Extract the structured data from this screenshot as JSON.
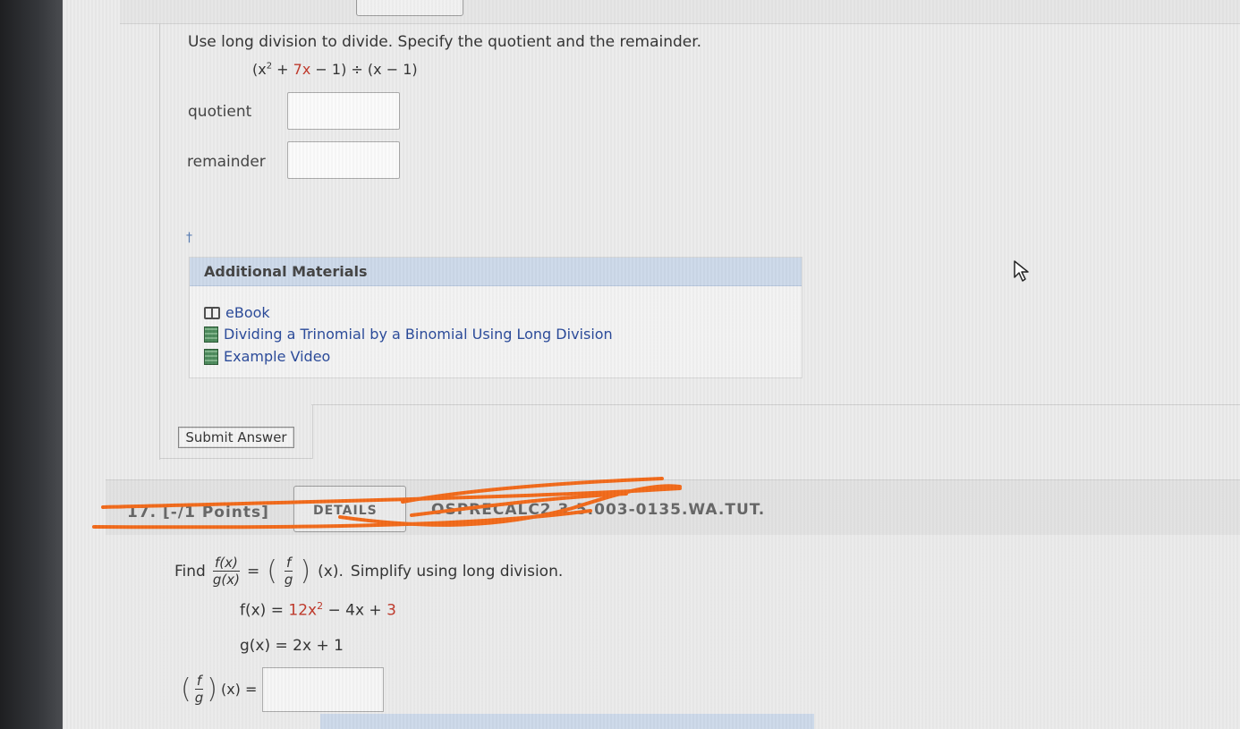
{
  "question": {
    "instruction": "Use long division to divide. Specify the quotient and the remainder.",
    "expression": {
      "part1": "(x",
      "exp": "2",
      "part2": " + ",
      "term2": "7x",
      "part3": " − 1) ÷ (x − 1)"
    },
    "fields": [
      {
        "label": "quotient",
        "value": ""
      },
      {
        "label": "remainder",
        "value": ""
      }
    ],
    "dagger": "†"
  },
  "additional_materials": {
    "header": "Additional Materials",
    "items": [
      {
        "label": "eBook",
        "icon": "book-icon"
      },
      {
        "label": "Dividing a Trinomial by a Binomial Using Long Division",
        "icon": "video-icon"
      },
      {
        "label": "Example Video",
        "icon": "video-icon"
      }
    ]
  },
  "submit": {
    "label": "Submit Answer"
  },
  "q17": {
    "number_points": "17. [-/1 Points]",
    "details_label": "DETAILS",
    "code": "OSPRECALC2 3.5.003-0135.WA.TUT.",
    "find": "Find",
    "f_num": "f(x)",
    "g_den": "g(x)",
    "eq": "=",
    "f": "f",
    "g": "g",
    "of_x": "(x).",
    "simplify": "Simplify using long division.",
    "fx_lhs": "f(x) = ",
    "fx_coef": "12x",
    "fx_exp": "2",
    "fx_mid": " − 4x + ",
    "fx_const": "3",
    "gx": "g(x) = 2x + 1",
    "result_suffix": "(x) =",
    "answer": ""
  },
  "colors": {
    "link": "#2a4a9a",
    "header_blue": "#cdd9ea",
    "red_term": "#c0392b",
    "scribble": "#f26a1b"
  }
}
